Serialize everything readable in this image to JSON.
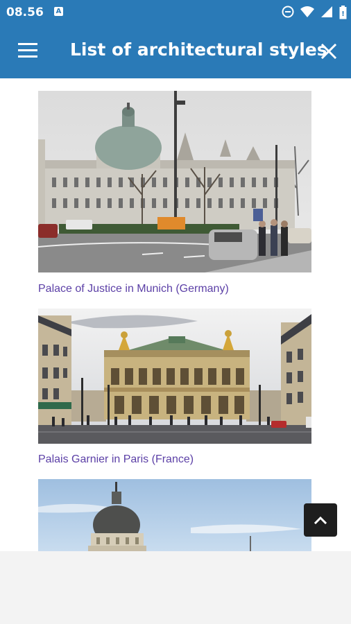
{
  "status_bar": {
    "time": "08.56",
    "notification_badge": "A",
    "icons": [
      "do-not-disturb-icon",
      "wifi-icon",
      "signal-icon",
      "battery-icon"
    ]
  },
  "toolbar": {
    "title": "List of architectural styles",
    "menu_icon": "hamburger-menu-icon",
    "close_icon": "close-icon",
    "background_color": "#2a7ab7"
  },
  "items": [
    {
      "caption": "Palace of Justice in Munich (Germany)"
    },
    {
      "caption": "Palais Garnier in Paris (France)"
    },
    {
      "caption": ""
    }
  ],
  "scroll_top_button": {
    "icon": "chevron-up-icon"
  },
  "colors": {
    "link": "#5b3fa6",
    "fab": "#1e1e1e"
  }
}
